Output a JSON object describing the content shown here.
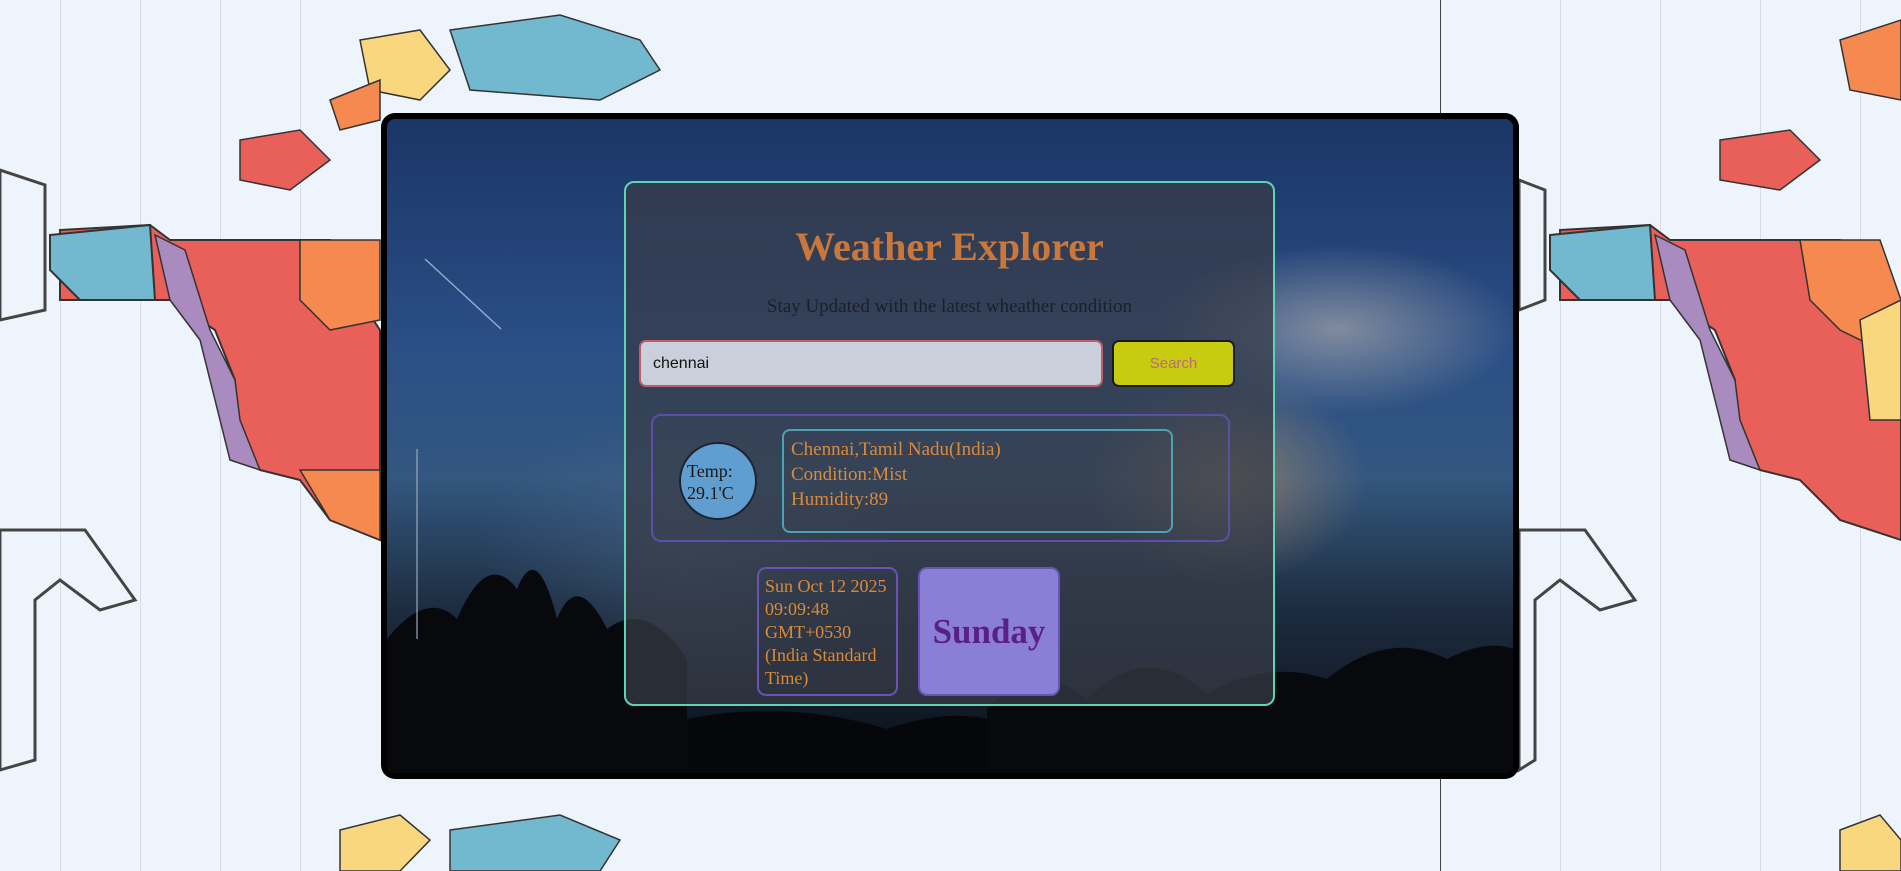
{
  "app": {
    "title": "Weather Explorer",
    "subtitle": "Stay Updated with the latest wheather condition"
  },
  "search": {
    "value": "chennai",
    "button_label": "Search"
  },
  "weather": {
    "temp_label": "Temp:",
    "temp_value": "29.1'C",
    "location": "Chennai,Tamil Nadu(India)",
    "condition_label": "Condition:",
    "condition_value": "Mist",
    "humidity_label": "Humidity:",
    "humidity_value": "89"
  },
  "datetime": {
    "full": "Sun Oct 12 2025 09:09:48 GMT+0530 (India Standard Time)",
    "day": "Sunday"
  },
  "colors": {
    "title": "#c9773a",
    "accent_border": "#5fd3b3",
    "search_button": "#c8cc10",
    "day_box": "#8a7fd6",
    "text_orange": "#d98a3a"
  }
}
